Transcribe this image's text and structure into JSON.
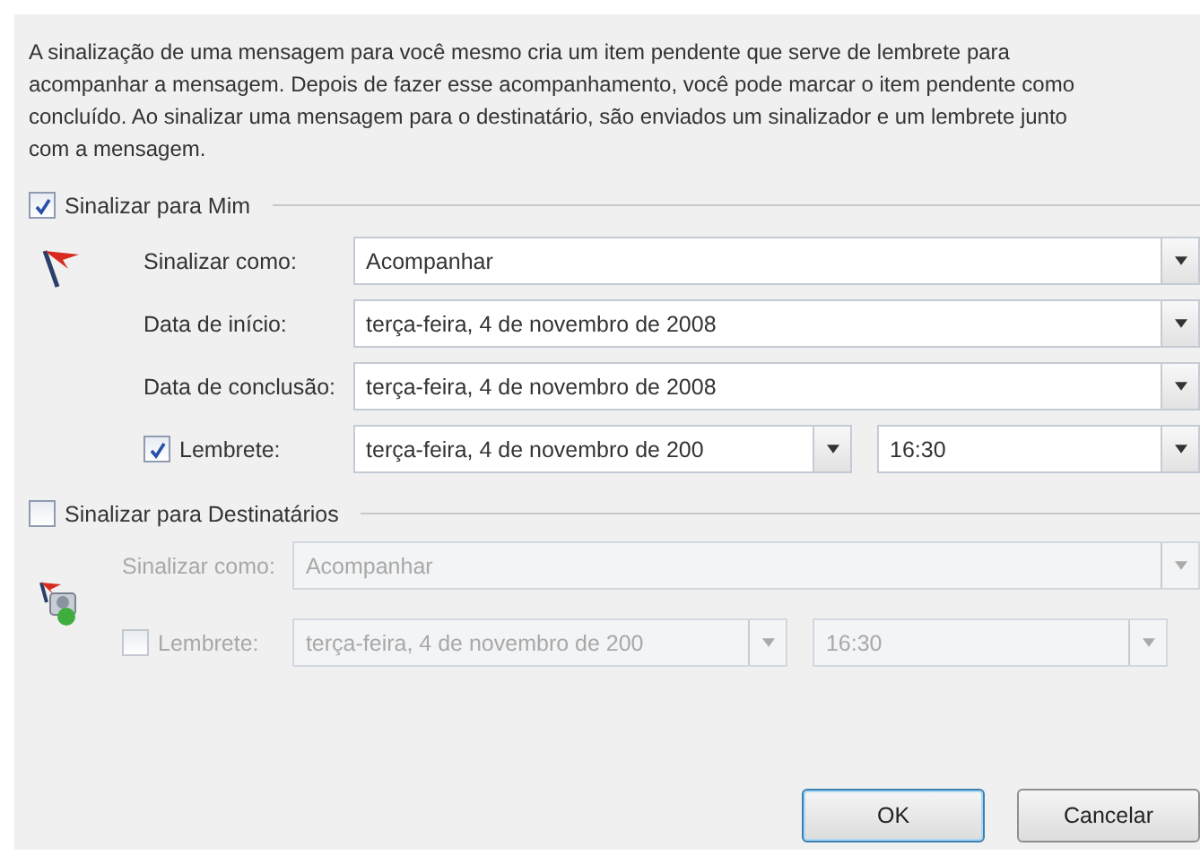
{
  "description": "A sinalização de uma mensagem para você mesmo cria um item pendente que serve de lembrete para acompanhar a mensagem. Depois de fazer esse acompanhamento, você pode marcar o item pendente como concluído. Ao sinalizar uma mensagem para o destinatário, são enviados um sinalizador e um lembrete junto com a mensagem.",
  "sections": [
    {
      "label": "Sinalizar para Mim",
      "checked": true,
      "disabled": false,
      "kind": "self",
      "fields": [
        {
          "kind": "dropdown",
          "label": "Sinalizar como:",
          "value": "Acompanhar"
        },
        {
          "kind": "dropdown",
          "label": "Data de início:",
          "value": "terça-feira, 4 de novembro de 2008"
        },
        {
          "kind": "dropdown",
          "label": "Data de conclusão:",
          "value": "terça-feira, 4 de novembro de 2008"
        },
        {
          "kind": "reminder",
          "label": "Lembrete:",
          "checked": true,
          "date": "terça-feira, 4 de novembro de 200",
          "time": "16:30"
        }
      ]
    },
    {
      "label": "Sinalizar para Destinatários",
      "checked": false,
      "disabled": true,
      "kind": "recipients",
      "fields": [
        {
          "kind": "dropdown",
          "label": "Sinalizar como:",
          "value": "Acompanhar"
        },
        {
          "kind": "reminder",
          "label": "Lembrete:",
          "checked": false,
          "date": "terça-feira, 4 de novembro de 200",
          "time": "16:30"
        }
      ]
    }
  ],
  "buttons": [
    {
      "label": "OK",
      "default": true
    },
    {
      "label": "Cancelar",
      "default": false
    }
  ]
}
